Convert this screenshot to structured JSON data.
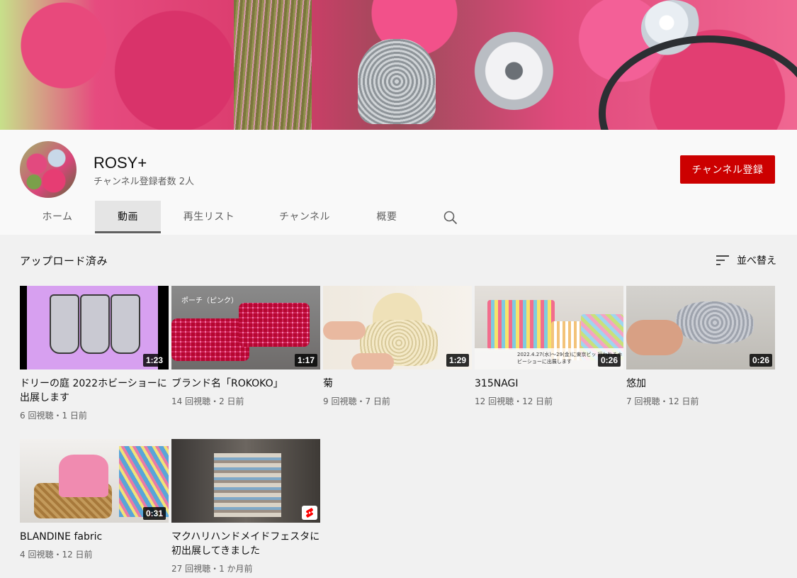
{
  "channel": {
    "name": "ROSY+",
    "subscribers": "チャンネル登録者数 2人",
    "subscribe_label": "チャンネル登録",
    "subscribe_color": "#cc0000"
  },
  "tabs": [
    {
      "label": "ホーム",
      "active": false
    },
    {
      "label": "動画",
      "active": true
    },
    {
      "label": "再生リスト",
      "active": false
    },
    {
      "label": "チャンネル",
      "active": false
    },
    {
      "label": "概要",
      "active": false
    }
  ],
  "section": {
    "title": "アップロード済み",
    "sort_label": "並べ替え"
  },
  "videos": [
    {
      "title": "ドリーの庭 2022ホビーショーに出展します",
      "meta": "6 回視聴・1 日前",
      "duration": "1:23"
    },
    {
      "title": "ブランド名「ROKOKO」",
      "meta": "14 回視聴・2 日前",
      "duration": "1:17",
      "thumb_text": "ポーチ（ピンク）"
    },
    {
      "title": "菊",
      "meta": "9 回視聴・7 日前",
      "duration": "1:29"
    },
    {
      "title": "315NAGI",
      "meta": "12 回視聴・12 日前",
      "duration": "0:26",
      "thumb_text": "2022.4.27(水)〜29(金)に東京ビッ 行われるホビーショーに出展します"
    },
    {
      "title": "悠加",
      "meta": "7 回視聴・12 日前",
      "duration": "0:26"
    },
    {
      "title": "BLANDINE fabric",
      "meta": "4 回視聴・12 日前",
      "duration": "0:31"
    },
    {
      "title": "マクハリハンドメイドフェスタに初出展してきました",
      "meta": "27 回視聴・1 か月前",
      "badge": "shorts-icon"
    }
  ]
}
